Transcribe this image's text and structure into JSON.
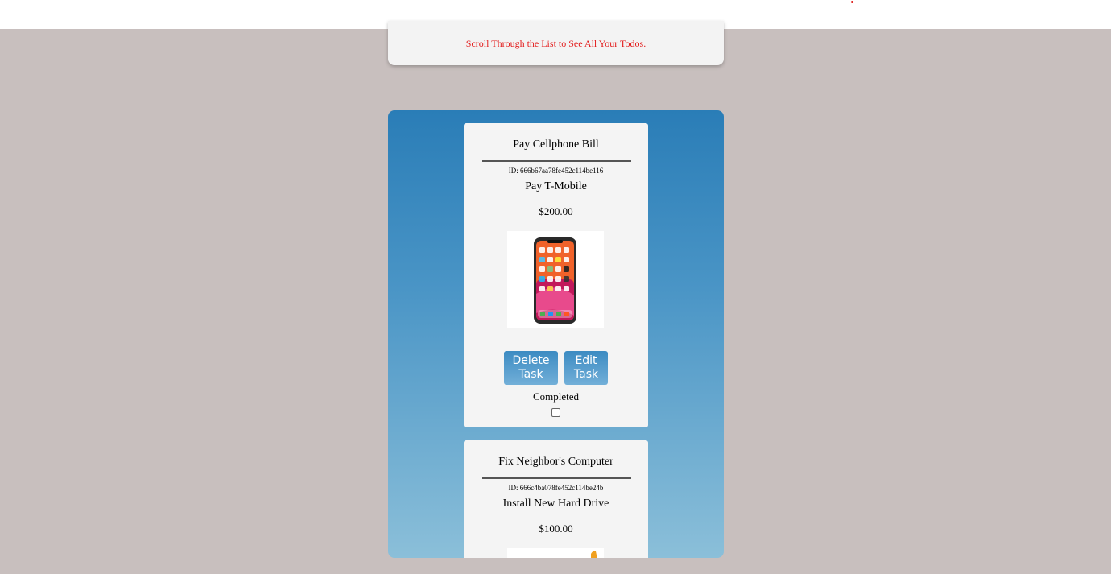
{
  "intro": {
    "text": "Scroll Through the List to See All Your Todos."
  },
  "todos": [
    {
      "title": "Pay Cellphone Bill",
      "id_text": "ID: 666b67aa78fe452c114be116",
      "description": "Pay T-Mobile",
      "price": "$200.00",
      "image": "smartphone-image",
      "delete_label": "Delete Task",
      "edit_label": "Edit Task",
      "completed_label": "Completed",
      "completed": false
    },
    {
      "title": "Fix Neighbor's Computer",
      "id_text": "ID: 666c4ba078fe452c114be24b",
      "description": "Install New Hard Drive",
      "price": "$100.00",
      "image": "computer-part-image"
    }
  ],
  "colors": {
    "page_background": "#c8bfbe",
    "intro_text": "#e31b1b",
    "panel_top": "#2a7db7",
    "panel_bottom": "#8bbfd9",
    "button": "#3c8bc2"
  }
}
